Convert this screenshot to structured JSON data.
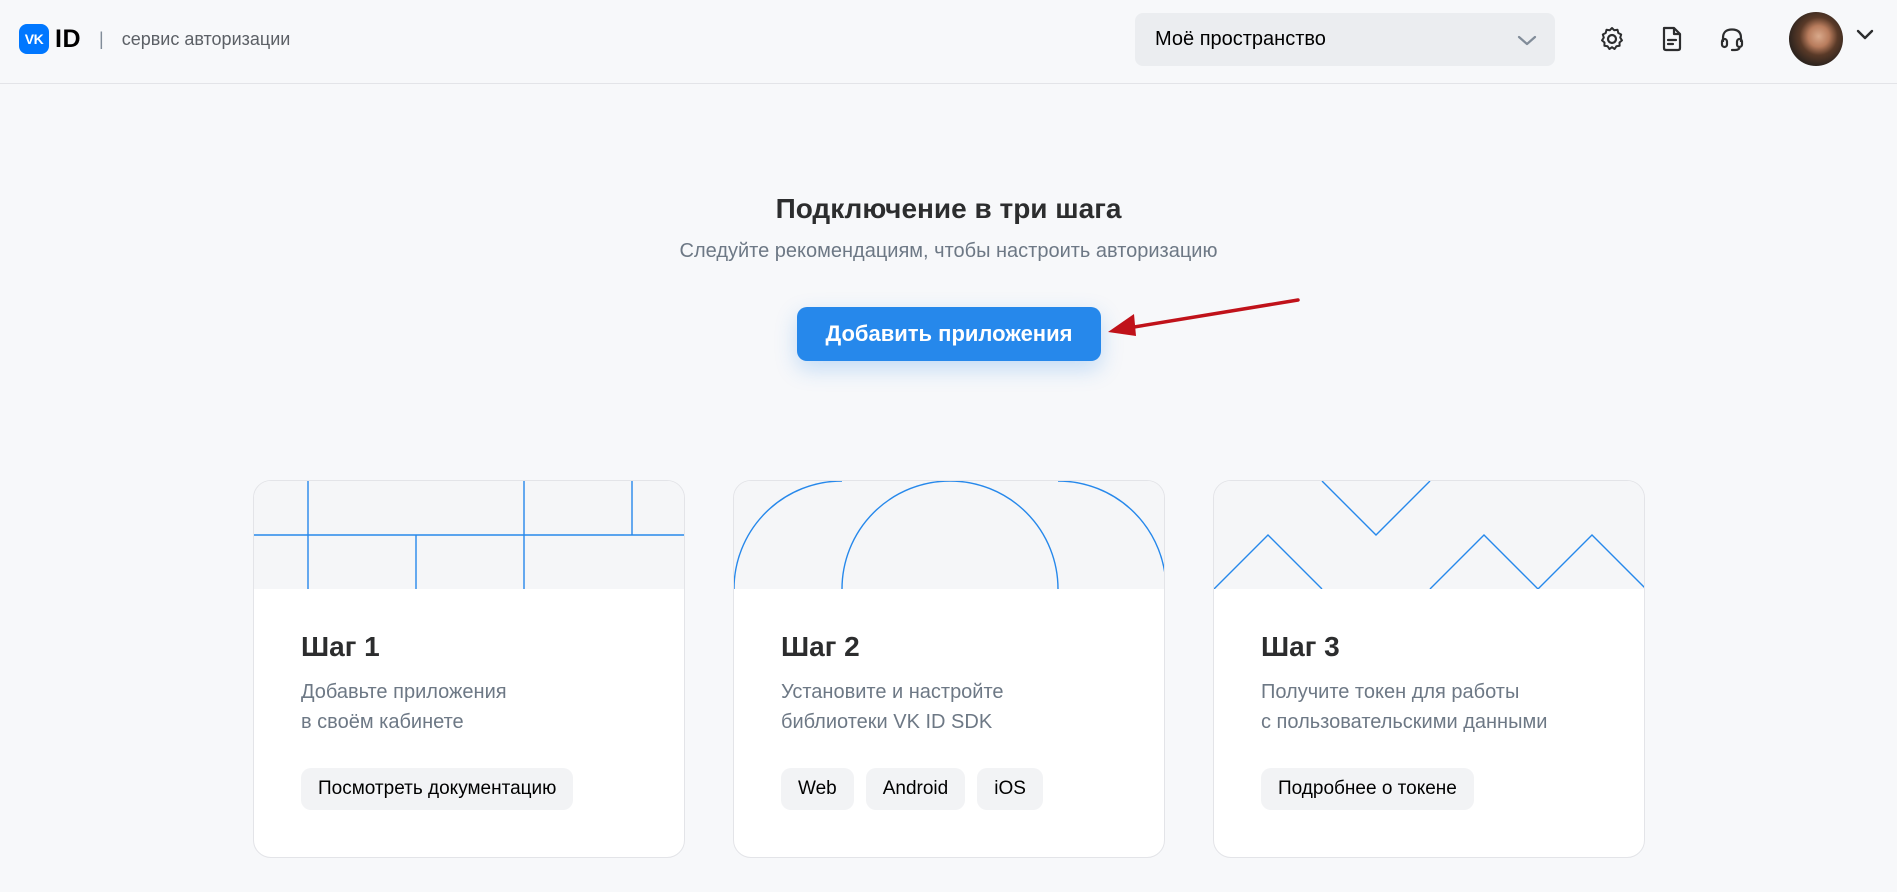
{
  "header": {
    "logo_badge": "VK",
    "logo_id": "ID",
    "separator": "|",
    "subtitle": "сервис авторизации",
    "space_select": {
      "value": "Моё пространство"
    },
    "icons": [
      "settings-icon",
      "document-icon",
      "support-icon"
    ]
  },
  "hero": {
    "title": "Подключение в три шага",
    "subtitle": "Следуйте рекомендациям, чтобы настроить авторизацию",
    "button_label": "Добавить приложения"
  },
  "steps": [
    {
      "title": "Шаг 1",
      "desc_line1": "Добавьте приложения",
      "desc_line2": "в своём кабинете",
      "chips": [
        "Посмотреть документацию"
      ]
    },
    {
      "title": "Шаг 2",
      "desc_line1": "Установите и настройте",
      "desc_line2": "библиотеки VK ID SDK",
      "chips": [
        "Web",
        "Android",
        "iOS"
      ]
    },
    {
      "title": "Шаг 3",
      "desc_line1": "Получите токен для работы",
      "desc_line2": "с пользовательскими данными",
      "chips": [
        "Подробнее о токене"
      ]
    }
  ],
  "colors": {
    "accent": "#2688eb",
    "vk_blue": "#0077ff",
    "annotation_arrow": "#c0121a"
  }
}
